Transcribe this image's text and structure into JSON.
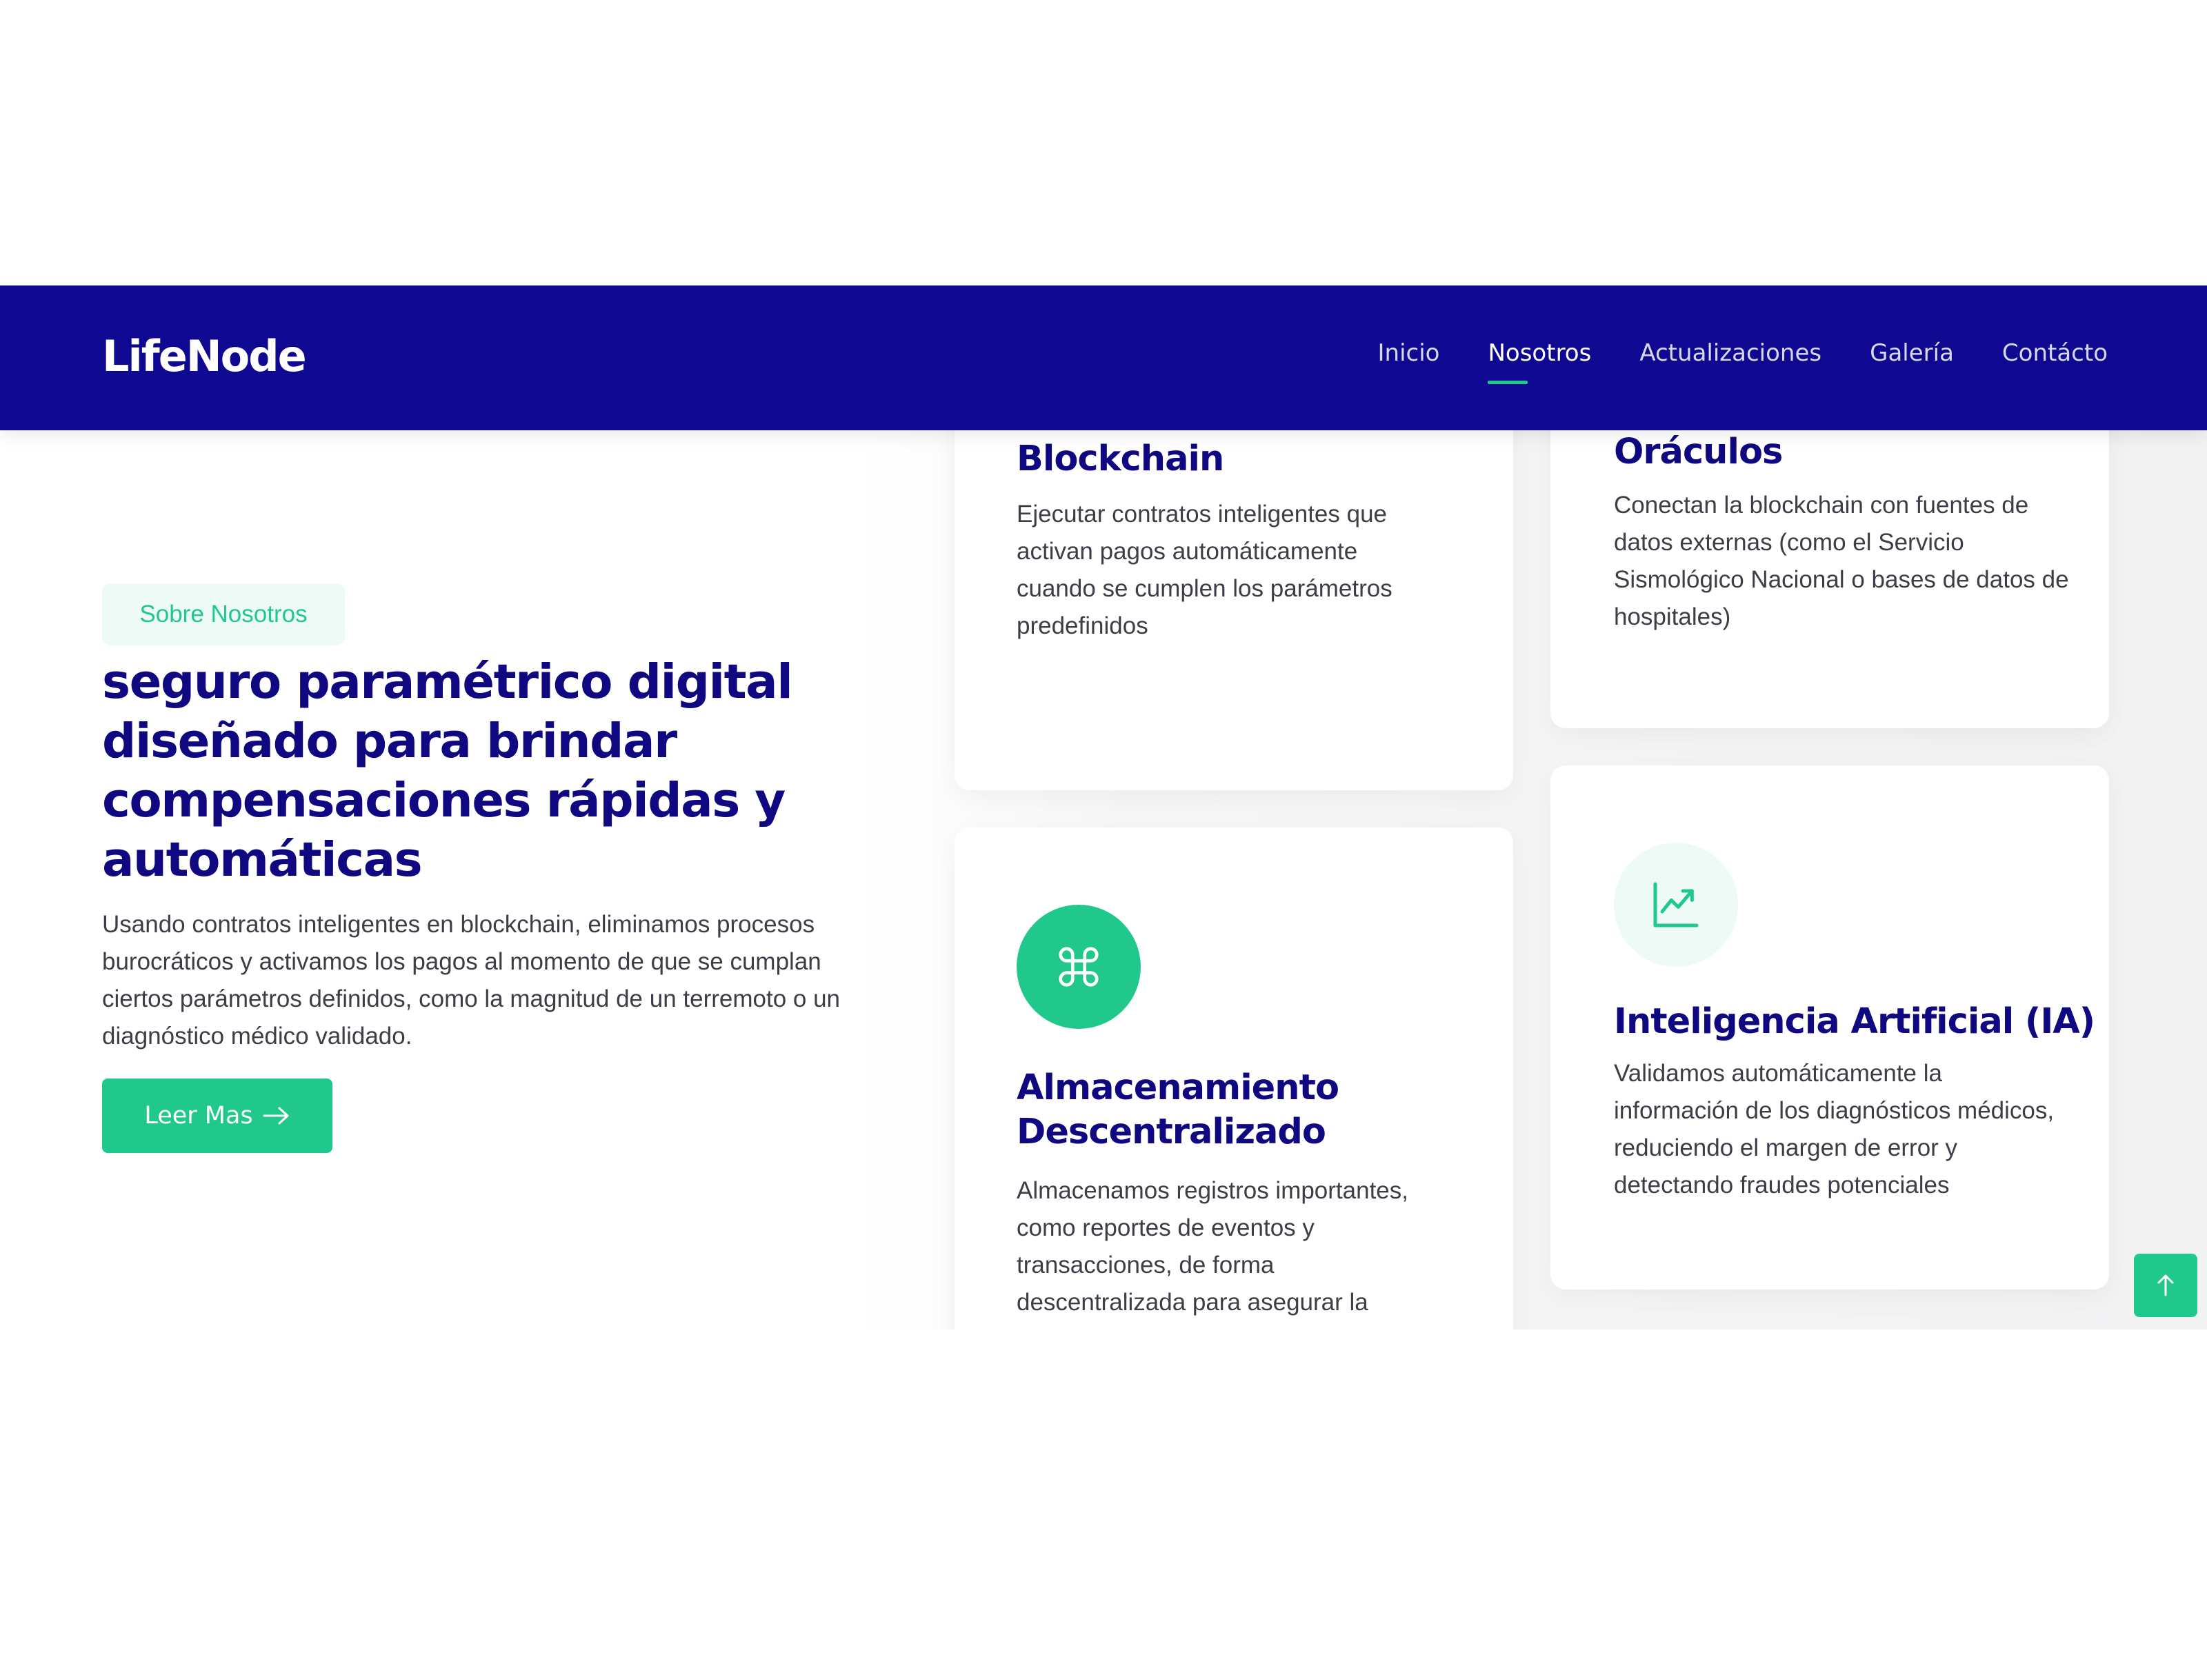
{
  "navbar": {
    "brand": "LifeNode",
    "links": [
      {
        "label": "Inicio",
        "active": false
      },
      {
        "label": "Nosotros",
        "active": true
      },
      {
        "label": "Actualizaciones",
        "active": false
      },
      {
        "label": "Galería",
        "active": false
      },
      {
        "label": "Contácto",
        "active": false
      }
    ]
  },
  "about": {
    "badge": "Sobre Nosotros",
    "title": "seguro paramétrico digital diseñado para brindar compensaciones rápidas y automáticas",
    "text": "Usando contratos inteligentes en blockchain, eliminamos procesos burocráticos y activamos los pagos al momento de que se cumplan ciertos parámetros definidos, como la magnitud de un terremoto o un diagnóstico médico validado.",
    "button": "Leer Mas"
  },
  "cards": [
    {
      "title": "Blockchain",
      "text": "Ejecutar contratos inteligentes que activan pagos automáticamente cuando se cumplen los parámetros predefinidos",
      "icon": "blockchain-icon"
    },
    {
      "title": "Oráculos",
      "text": "Conectan la blockchain con fuentes de datos externas (como el Servicio Sismológico Nacional o bases de datos de hospitales)",
      "icon": "oracle-icon"
    },
    {
      "title": "Almacenamiento Descentralizado",
      "text": "Almacenamos registros importantes, como reportes de eventos y transacciones, de forma descentralizada para asegurar la integridad de los documentos",
      "icon": "command-icon"
    },
    {
      "title": "Inteligencia Artificial (IA)",
      "text": "Validamos automáticamente la información de los diagnósticos médicos, reduciendo el margen de error y detectando fraudes potenciales",
      "icon": "trending-up-icon"
    }
  ],
  "colors": {
    "navy": "#0f0891",
    "accent": "#20c98b"
  }
}
